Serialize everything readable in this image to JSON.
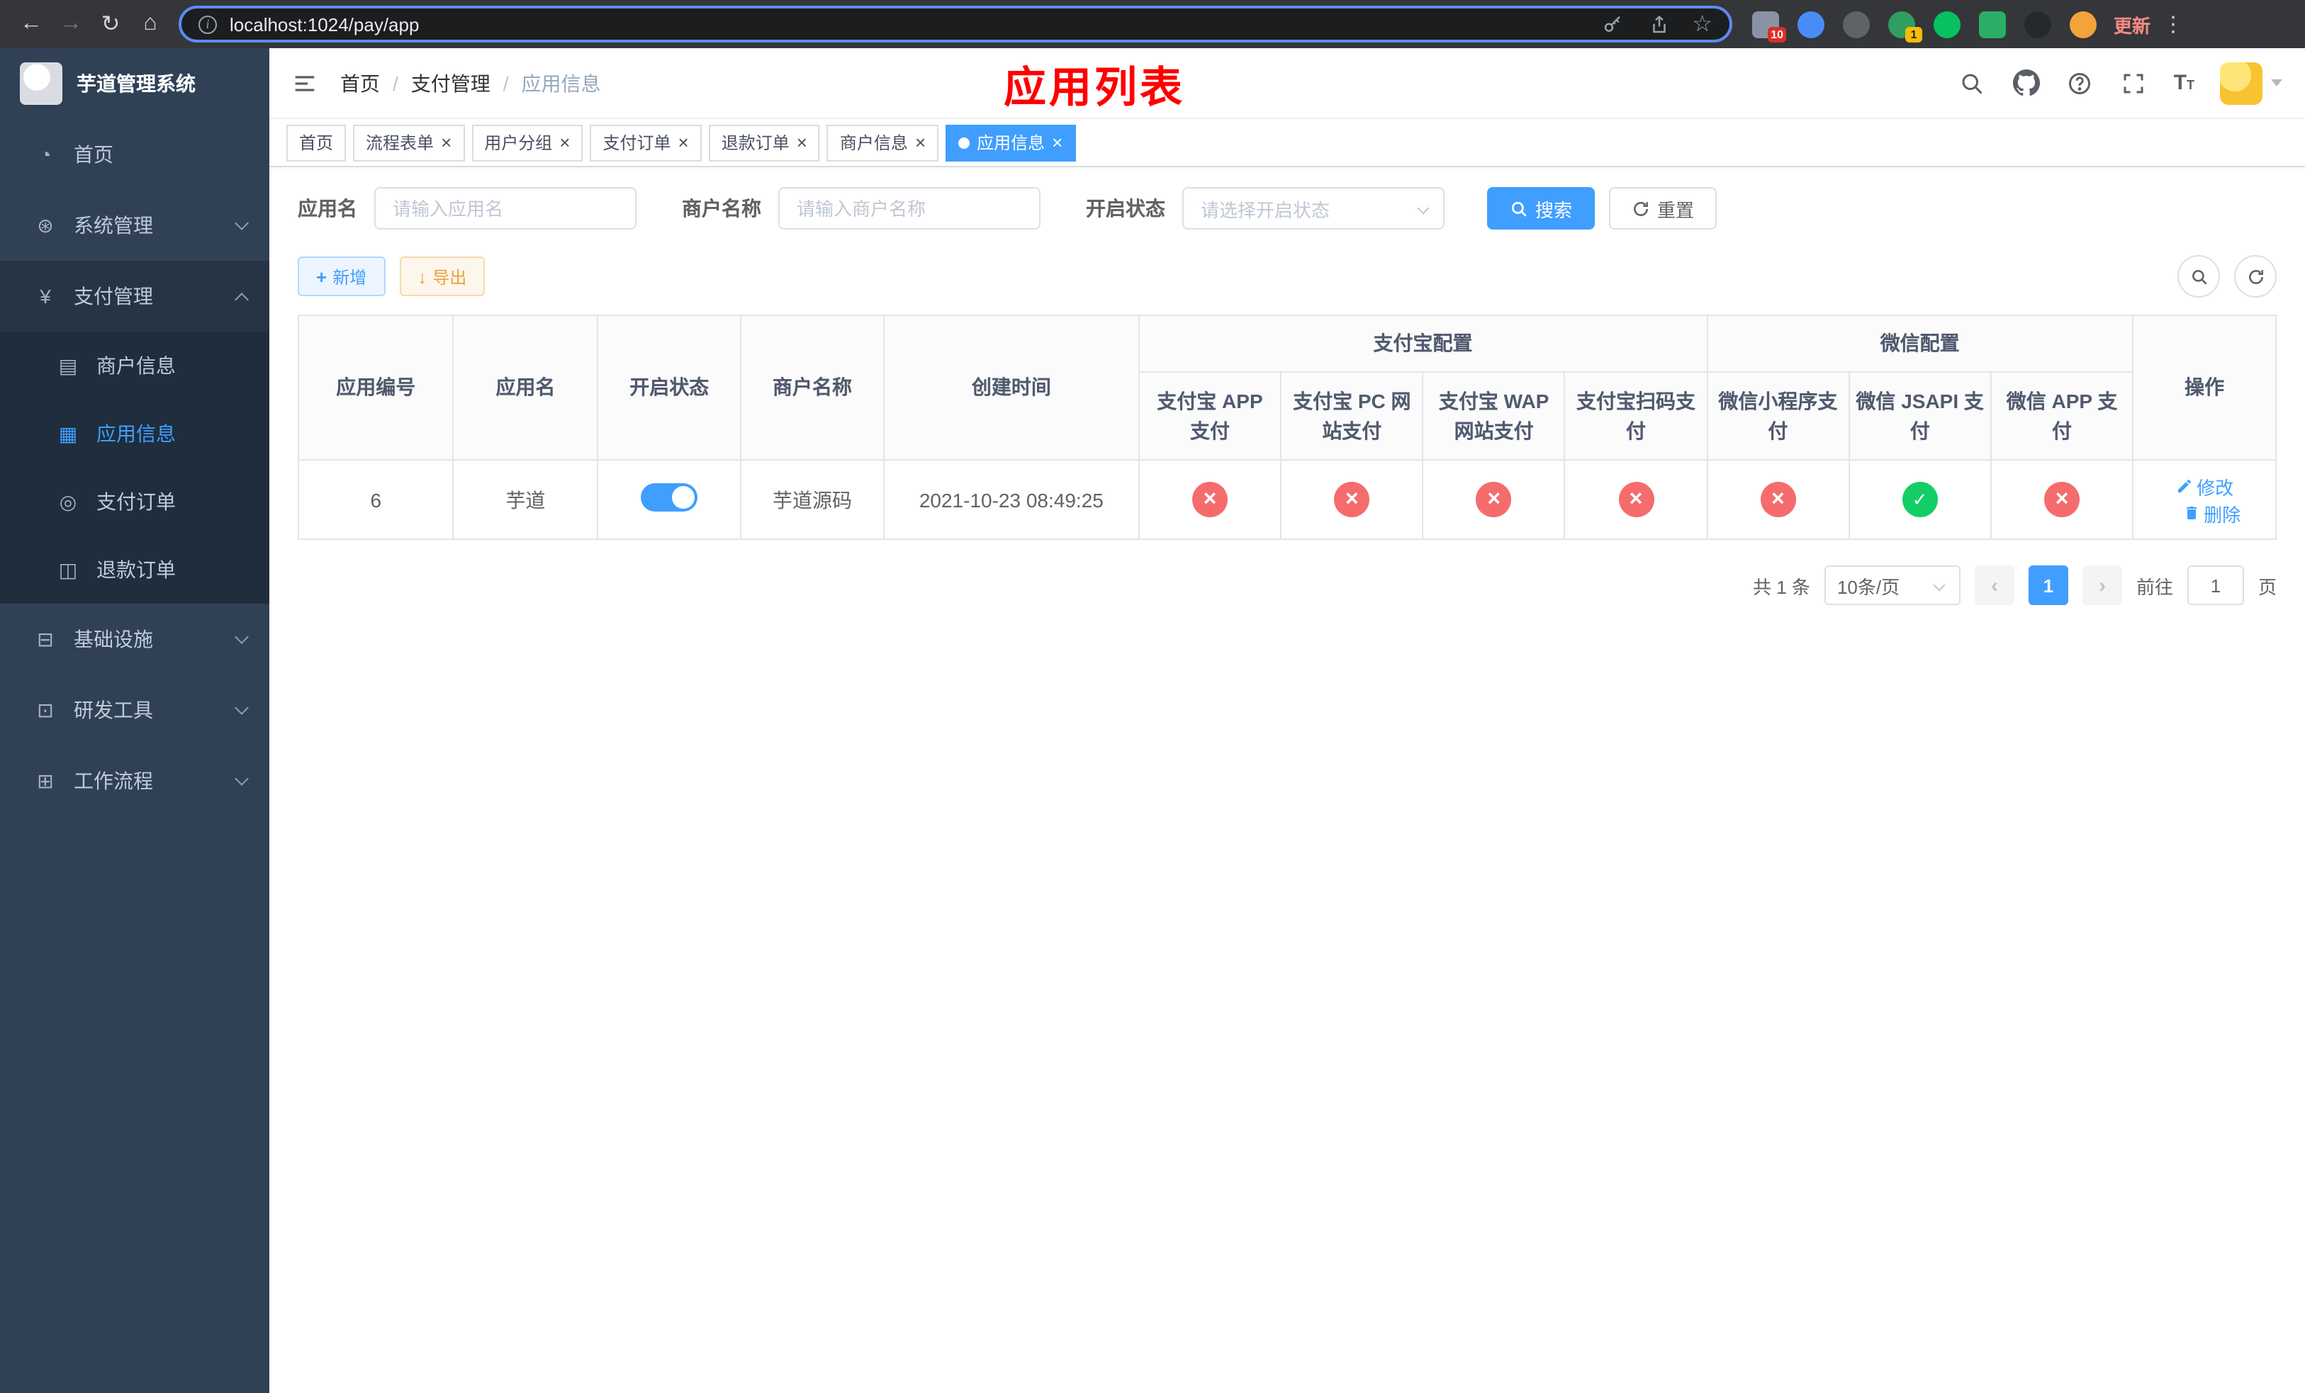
{
  "browser": {
    "url": "localhost:1024/pay/app",
    "update_label": "更新",
    "extensions": [
      {
        "color": "#8a93a5",
        "badge": "10"
      },
      {
        "color": "#4a8cf7",
        "badge": ""
      },
      {
        "color": "#5f6368",
        "badge": ""
      },
      {
        "color": "#2f9e62",
        "badge": "1"
      },
      {
        "color": "#07c160",
        "badge": ""
      },
      {
        "color": "#2aae67",
        "badge": ""
      },
      {
        "color": "#24292e",
        "badge": ""
      },
      {
        "color": "#f2a33c",
        "badge": ""
      }
    ]
  },
  "icons": {
    "back": "←",
    "forward": "→",
    "reload": "↻",
    "home": "⌂",
    "info": "i",
    "star": "☆",
    "menu_dots": "⋮",
    "dashboard": "◔",
    "gear": "⊛",
    "yuan": "¥",
    "merchant": "▤",
    "app": "▦",
    "order": "◎",
    "refund": "◫",
    "infra": "⊟",
    "tools": "⊡",
    "workflow": "⊞",
    "plus": "+",
    "download": "↓",
    "prev": "‹",
    "next": "›",
    "font_big": "T",
    "font_small": "T",
    "close": "×"
  },
  "sidebar": {
    "title": "芋道管理系统",
    "menu": {
      "home": "首页",
      "system": "系统管理",
      "payment": "支付管理",
      "infra": "基础设施",
      "devtools": "研发工具",
      "workflow": "工作流程"
    },
    "payment_children": {
      "merchant": "商户信息",
      "app": "应用信息",
      "order": "支付订单",
      "refund": "退款订单"
    }
  },
  "header": {
    "breadcrumb": [
      "首页",
      "支付管理",
      "应用信息"
    ],
    "separator": "/",
    "page_title": "应用列表"
  },
  "tabs": [
    {
      "label": "首页"
    },
    {
      "label": "流程表单"
    },
    {
      "label": "用户分组"
    },
    {
      "label": "支付订单"
    },
    {
      "label": "退款订单"
    },
    {
      "label": "商户信息"
    },
    {
      "label": "应用信息"
    }
  ],
  "filters": {
    "app_name": {
      "label": "应用名",
      "placeholder": "请输入应用名"
    },
    "merchant_name": {
      "label": "商户名称",
      "placeholder": "请输入商户名称"
    },
    "status": {
      "label": "开启状态",
      "placeholder": "请选择开启状态"
    },
    "search": "搜索",
    "reset": "重置"
  },
  "toolbar": {
    "add": "新增",
    "export": "导出"
  },
  "table": {
    "groups": {
      "alipay": "支付宝配置",
      "wechat": "微信配置"
    },
    "columns": {
      "id": "应用编号",
      "name": "应用名",
      "status": "开启状态",
      "merchant": "商户名称",
      "created": "创建时间",
      "alipay_app": "支付宝 APP 支付",
      "alipay_pc": "支付宝 PC 网站支付",
      "alipay_wap": "支付宝 WAP 网站支付",
      "alipay_qr": "支付宝扫码支付",
      "wx_lite": "微信小程序支付",
      "wx_jsapi": "微信 JSAPI 支付",
      "wx_app": "微信 APP 支付",
      "actions": "操作"
    },
    "rows": [
      {
        "id": "6",
        "name": "芋道",
        "enabled": true,
        "merchant": "芋道源码",
        "created": "2021-10-23 08:49:25",
        "configs": {
          "alipay_app": false,
          "alipay_pc": false,
          "alipay_wap": false,
          "alipay_qr": false,
          "wx_lite": false,
          "wx_jsapi": true,
          "wx_app": false
        },
        "actions": {
          "edit": "修改",
          "delete": "删除"
        }
      }
    ]
  },
  "pagination": {
    "total": "共 1 条",
    "page_size": "10条/页",
    "current": "1",
    "goto_label": "前往",
    "goto_value": "1",
    "page_unit": "页"
  }
}
